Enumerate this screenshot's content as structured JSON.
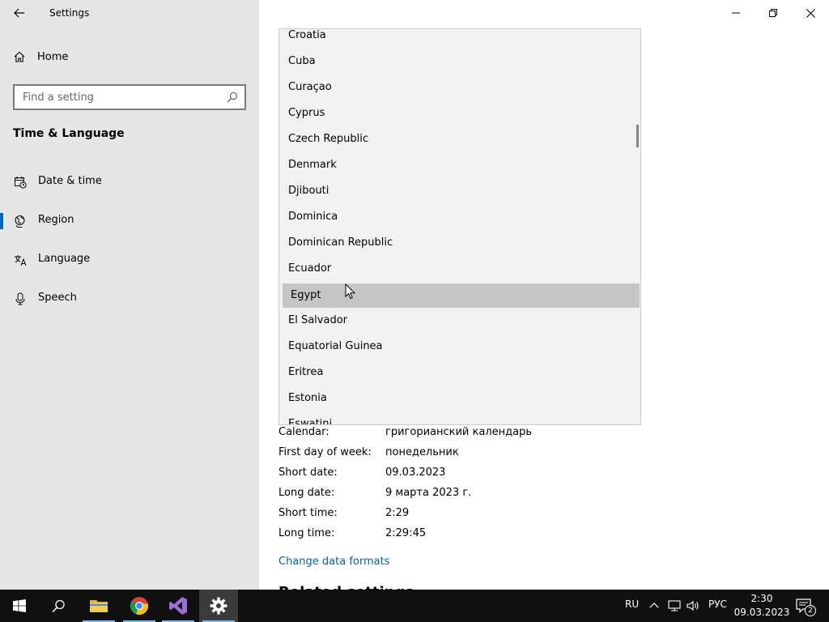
{
  "window": {
    "title": "Settings"
  },
  "nav": {
    "home_label": "Home",
    "search_placeholder": "Find a setting",
    "section_title": "Time & Language",
    "items": [
      {
        "label": "Date & time",
        "icon": "calendar-clock-icon",
        "active": false
      },
      {
        "label": "Region",
        "icon": "globe-icon",
        "active": true
      },
      {
        "label": "Language",
        "icon": "language-icon",
        "active": false
      },
      {
        "label": "Speech",
        "icon": "microphone-icon",
        "active": false
      }
    ]
  },
  "country_list": {
    "highlighted": "Egypt",
    "items": [
      "Croatia",
      "Cuba",
      "Curaçao",
      "Cyprus",
      "Czech Republic",
      "Denmark",
      "Djibouti",
      "Dominica",
      "Dominican Republic",
      "Ecuador",
      "Egypt",
      "El Salvador",
      "Equatorial Guinea",
      "Eritrea",
      "Estonia",
      "Eswatini"
    ]
  },
  "region_format": {
    "rows": [
      {
        "label": "Calendar:",
        "value": "григорианский календарь"
      },
      {
        "label": "First day of week:",
        "value": "понедельник"
      },
      {
        "label": "Short date:",
        "value": "09.03.2023"
      },
      {
        "label": "Long date:",
        "value": "9 марта 2023 г."
      },
      {
        "label": "Short time:",
        "value": "2:29"
      },
      {
        "label": "Long time:",
        "value": "2:29:45"
      }
    ],
    "change_link": "Change data formats",
    "related_title": "Related settings"
  },
  "taskbar": {
    "input_lang": "RU",
    "keyboard_layout": "РУС",
    "time": "2:30",
    "date": "09.03.2023",
    "notification_count": "2"
  },
  "colors": {
    "accent": "#0067c0",
    "link": "#0063b1",
    "sidebar_bg": "#e6e6e6",
    "taskbar_bg": "#101010",
    "highlight": "#c6c6c6"
  }
}
